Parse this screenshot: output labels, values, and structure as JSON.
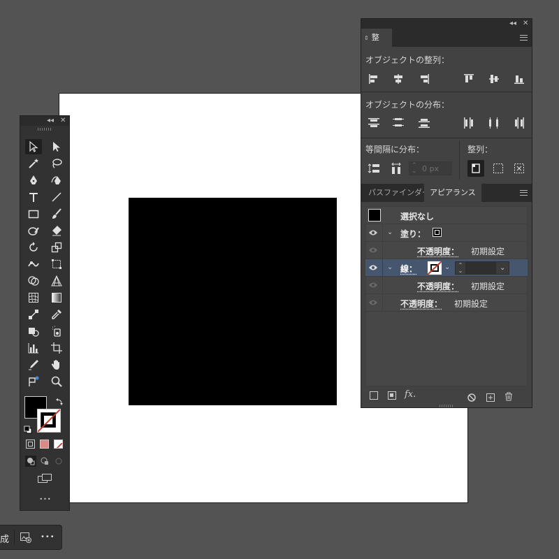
{
  "toolbox": {
    "collapse_glyph": "◂◂",
    "close_glyph": "✕",
    "more_glyph": "•••"
  },
  "align_panel": {
    "collapse_glyph": "◂◂",
    "close_glyph": "✕",
    "tab_label": "整列",
    "object_align_label": "オブジェクトの整列：",
    "object_distribute_label": "オブジェクトの分布：",
    "spacing_label": "等間隔に分布：",
    "align_to_label": "整列：",
    "spacing_value": "0 px"
  },
  "lower_tabs": {
    "pathfinder": "パスファインダー",
    "appearance": "アピアランス"
  },
  "appearance": {
    "selection": "選択なし",
    "fill_label": "塗り：",
    "opacity_label": "不透明度：",
    "opacity_value": "初期設定",
    "stroke_label": "線：",
    "fx_label": "fx."
  },
  "bottom_bar": {
    "label": "成",
    "more_glyph": "•••"
  },
  "colors": {
    "workspace": "#535353",
    "panel": "#323232",
    "selected_row": "#46566f",
    "square": "#000000"
  }
}
